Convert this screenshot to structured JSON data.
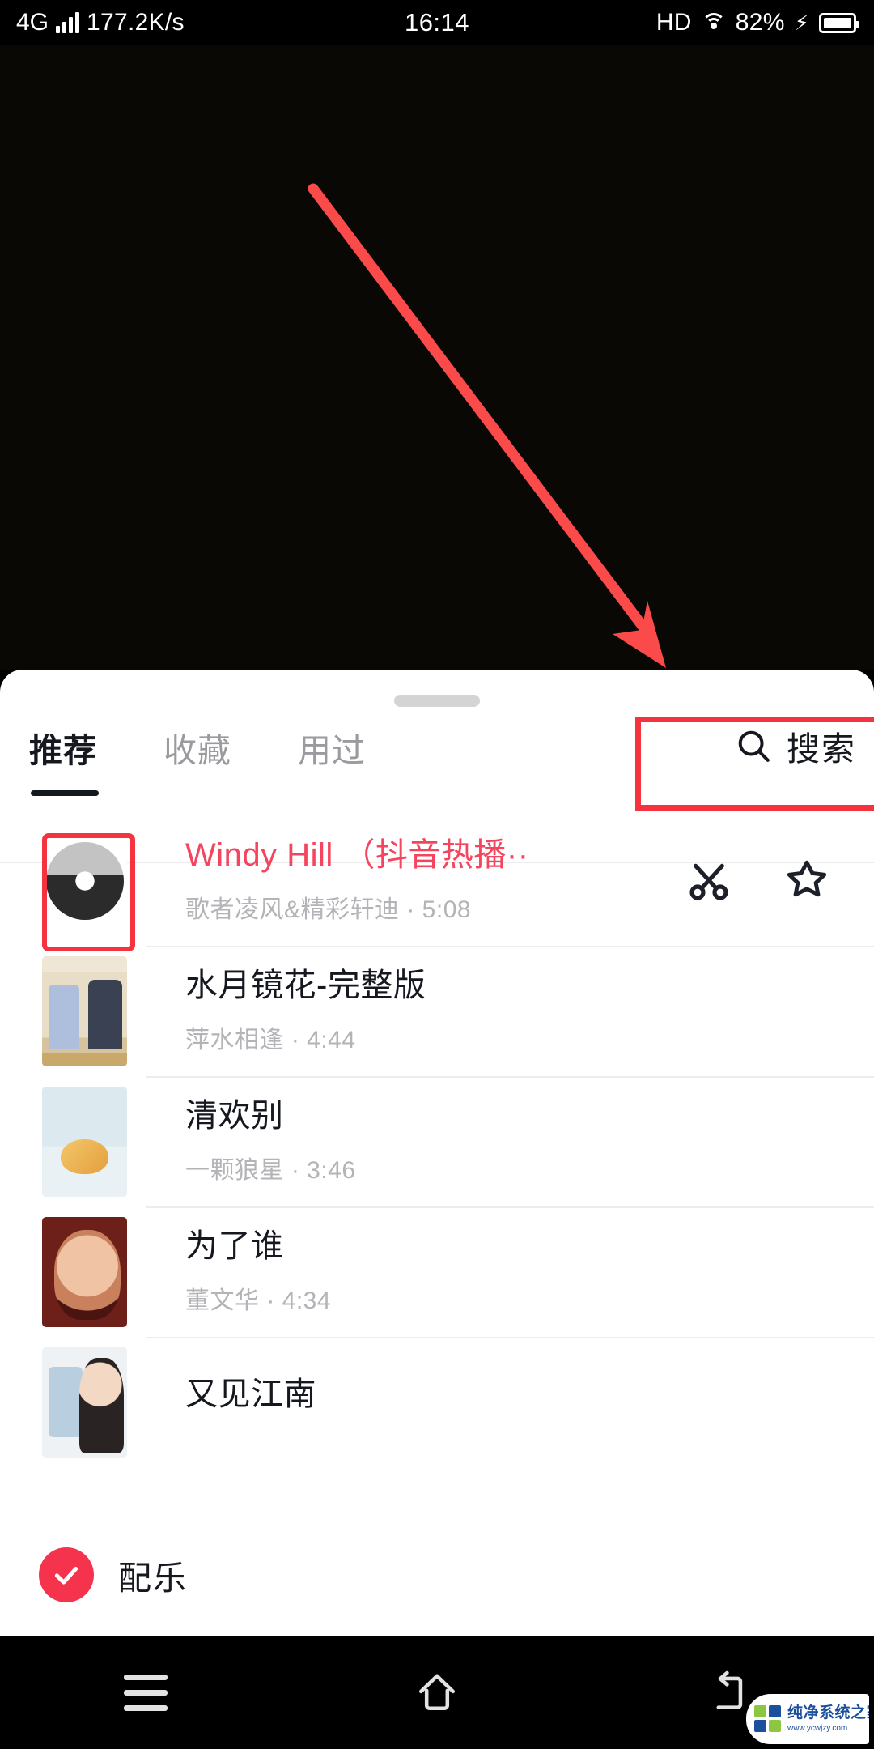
{
  "status_bar": {
    "network_type": "4G",
    "data_rate": "177.2K/s",
    "time": "16:14",
    "hd_label": "HD",
    "battery_percent": "82%",
    "icons": [
      "signal-bars-icon",
      "wifi-icon",
      "charging-bolt-icon",
      "battery-icon"
    ]
  },
  "annotations": {
    "arrow_color": "#fa4a4a",
    "highlight_color": "#f5333f",
    "arrow_points_to": "search-button",
    "boxes": [
      "search-button",
      "first-track-cover"
    ]
  },
  "sheet": {
    "drag_handle": "drag-handle",
    "tabs": [
      {
        "label": "推荐",
        "active": true
      },
      {
        "label": "收藏",
        "active": false
      },
      {
        "label": "用过",
        "active": false
      }
    ],
    "search": {
      "label": "搜索",
      "icon": "search-icon"
    },
    "tracks": [
      {
        "title": "Windy Hill （抖音热播··",
        "artist_duration": "歌者凌风&精彩轩迪 · 5:08",
        "selected": true,
        "actions": [
          "cut-icon",
          "star-icon"
        ]
      },
      {
        "title": "水月镜花-完整版",
        "artist_duration": "萍水相逢 · 4:44",
        "selected": false,
        "actions": []
      },
      {
        "title": "清欢别",
        "artist_duration": "一颗狼星 · 3:46",
        "selected": false,
        "actions": []
      },
      {
        "title": "为了谁",
        "artist_duration": "董文华 · 4:34",
        "selected": false,
        "actions": []
      },
      {
        "title": "又见江南",
        "artist_duration": "",
        "selected": false,
        "actions": []
      }
    ],
    "soundtrack_bar": {
      "label": "配乐",
      "checked": true,
      "accent_color": "#f5334c"
    }
  },
  "nav_bar": {
    "buttons": [
      {
        "name": "menu-button",
        "icon": "hamburger-icon"
      },
      {
        "name": "home-button",
        "icon": "home-icon"
      },
      {
        "name": "back-button",
        "icon": "back-arrow-icon"
      }
    ]
  },
  "watermark": {
    "brand": "纯净系统之家",
    "url": "www.ycwjzy.com"
  }
}
